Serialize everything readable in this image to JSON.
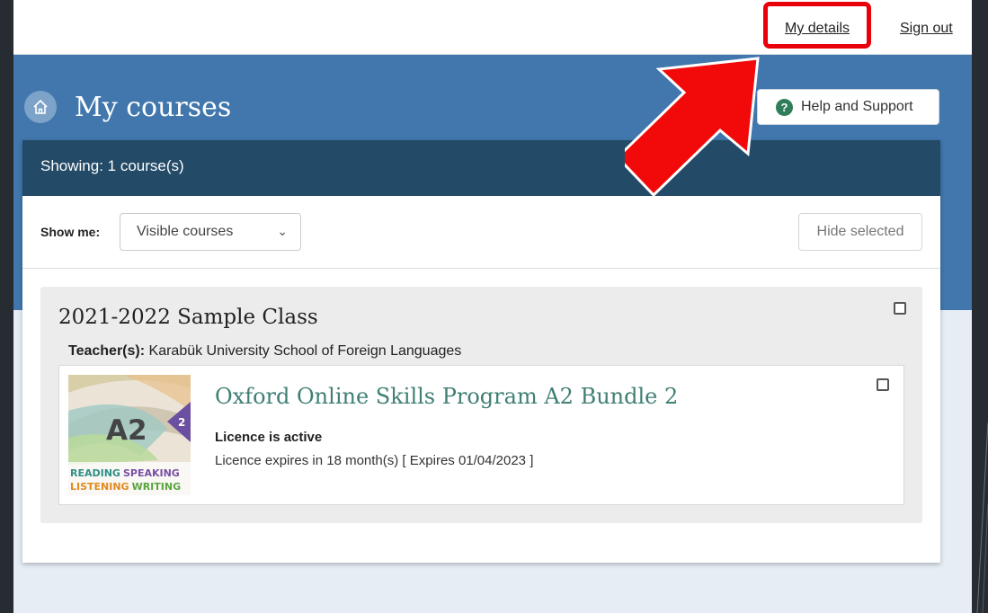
{
  "topbar": {
    "my_details": "My details",
    "sign_out": "Sign out"
  },
  "header": {
    "page_title": "My courses",
    "help_button": "Help and Support"
  },
  "course_list": {
    "showing_text": "Showing: 1 course(s)",
    "show_me_label": "Show me:",
    "filter_selected": "Visible courses",
    "hide_selected_label": "Hide selected"
  },
  "class": {
    "title": "2021-2022 Sample Class",
    "teacher_label": "Teacher(s):",
    "teacher_value": "Karabük University School of Foreign Languages",
    "product": {
      "title": "Oxford Online Skills Program A2 Bundle 2",
      "licence_status": "Licence is active",
      "licence_expiry": "Licence expires in 18 month(s) [ Expires 01/04/2023 ]",
      "cover": {
        "level": "A2",
        "bundle": "2",
        "skills": {
          "reading": "READING",
          "speaking": "SPEAKING",
          "listening": "LISTENING",
          "writing": "WRITING"
        }
      }
    }
  },
  "icons": [
    "home-icon",
    "help-icon",
    "chevron-down-icon",
    "checkbox-icon",
    "arrow-pointer-icon"
  ],
  "colors": {
    "brand_blue": "#4177ad",
    "header_dark": "#234a66",
    "product_link": "#3f7f74",
    "highlight_red": "#e8000b",
    "help_green": "#2e7d5b"
  }
}
